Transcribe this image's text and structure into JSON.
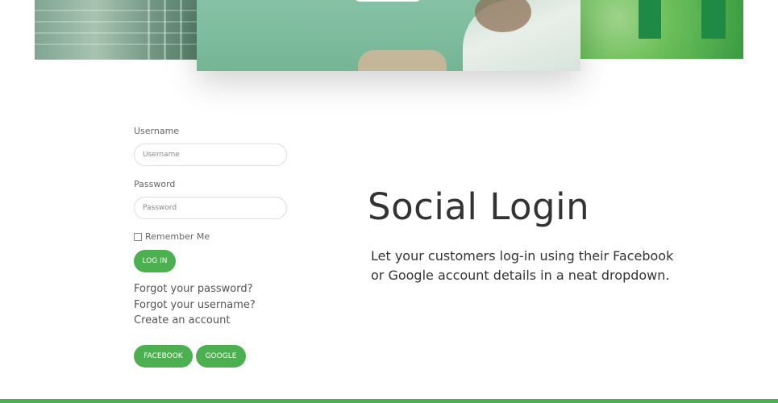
{
  "login_form": {
    "username_label": "Username",
    "username_placeholder": "Username",
    "password_label": "Password",
    "password_placeholder": "Password",
    "remember_label": "Remember Me",
    "login_button": "LOG IN",
    "links": [
      "Forgot your password?",
      "Forgot your username?",
      "Create an account"
    ],
    "social_buttons": [
      "FACEBOOK",
      "GOOGLE"
    ]
  },
  "feature": {
    "title": "Social Login",
    "description": "Let your customers log-in using their Facebook or Google account details in a neat dropdown."
  },
  "colors": {
    "accent": "#4caf50",
    "text": "#333333"
  }
}
